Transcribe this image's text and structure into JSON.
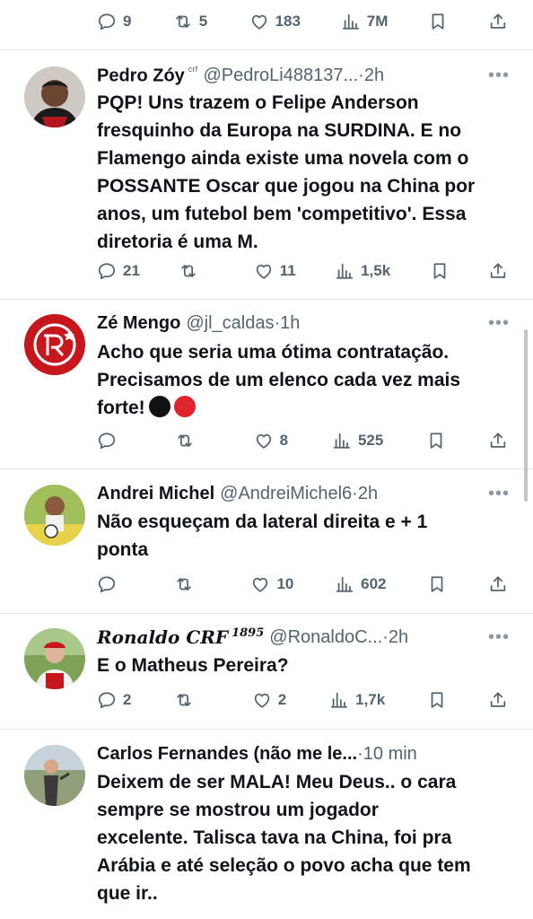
{
  "top_actions": {
    "replies": "9",
    "reposts": "5",
    "likes": "183",
    "views": "7M"
  },
  "tweets": [
    {
      "name": "Pedro Zóy",
      "name_suffix": "ᶜʳᶠ",
      "handle": "@PedroLi488137...",
      "sep": " · ",
      "time": "2h",
      "text": "PQP! Uns trazem o Felipe Anderson\nfresquinho da Europa na SURDINA. E no\nFlamengo ainda existe uma novela com o\nPOSSANTE Oscar que jogou na China por\nanos, um futebol bem 'competitivo'. Essa\ndiretoria é uma M.",
      "replies": "21",
      "reposts": "",
      "likes": "11",
      "views": "1,5k"
    },
    {
      "name": "Zé Mengo",
      "handle": "@jl_caldas",
      "sep": " · ",
      "time": "1h",
      "text": "Acho que seria uma ótima contratação.\nPrecisamos de um elenco cada vez mais\nforte!",
      "replies": "",
      "reposts": "",
      "likes": "8",
      "views": "525"
    },
    {
      "name": "Andrei Michel",
      "handle": "@AndreiMichel6",
      "sep": " · ",
      "time": "2h",
      "text": "Não esqueçam da lateral direita e + 1\nponta",
      "replies": "",
      "reposts": "",
      "likes": "10",
      "views": "602"
    },
    {
      "name": "Ronaldo CRF",
      "name_suffix": "1895",
      "handle": "@RonaldoC...",
      "sep": " · ",
      "time": "2h",
      "text": "E o Matheus Pereira?",
      "replies": "2",
      "reposts": "",
      "likes": "2",
      "views": "1,7k"
    },
    {
      "name": "Carlos Fernandes (não me le...",
      "handle": "",
      "sep": " · ",
      "time": "10 min",
      "text": "Deixem de ser MALA! Meu Deus.. o cara\nsempre se mostrou um jogador\nexcelente. Talisca tava na China, foi pra\nArábia e até seleção o povo acha que tem\nque ir.."
    }
  ],
  "colors": {
    "text": "#0f1419",
    "muted": "#536471",
    "divider": "#e6e9ec"
  }
}
